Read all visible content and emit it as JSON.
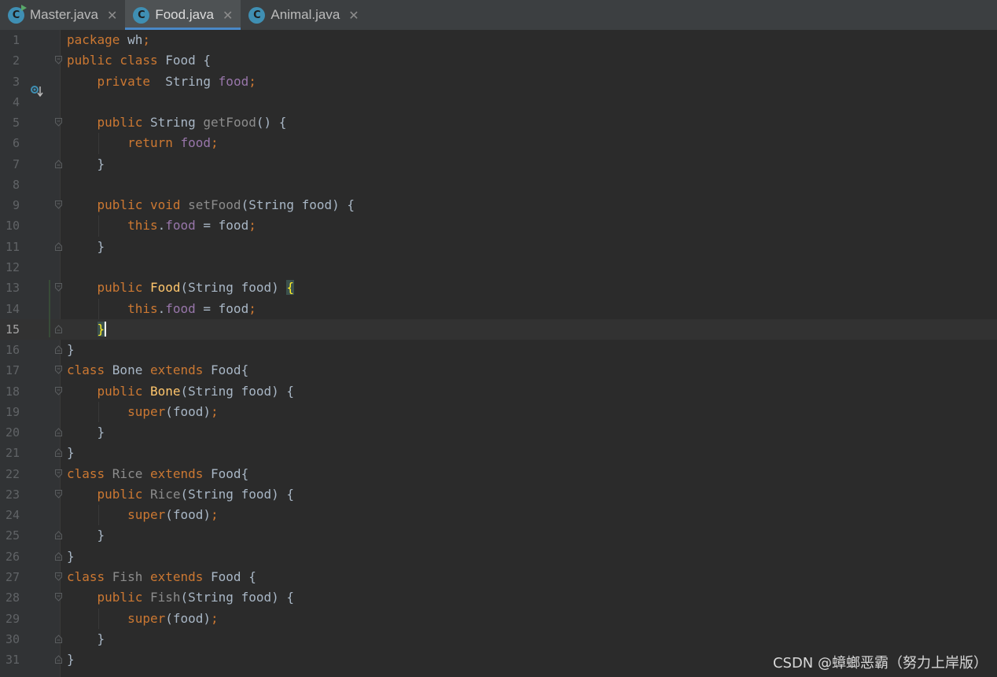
{
  "tabs": [
    {
      "name": "Master.java",
      "icon": "java-class-run-icon",
      "active": false
    },
    {
      "name": "Food.java",
      "icon": "java-class-icon",
      "active": true
    },
    {
      "name": "Animal.java",
      "icon": "java-class-icon",
      "active": false
    }
  ],
  "tab_close_glyph": "✕",
  "tab_icon_letter": "C",
  "editor": {
    "current_line": 15,
    "lines": [
      {
        "n": "1",
        "tokens": [
          [
            "package",
            "kw"
          ],
          [
            " wh",
            "plain"
          ],
          [
            ";",
            "kw"
          ]
        ]
      },
      {
        "n": "2",
        "tokens": [
          [
            "public class ",
            "kw"
          ],
          [
            "Food {",
            "plain"
          ]
        ]
      },
      {
        "n": "3",
        "tokens": [
          [
            "    private  ",
            "kw"
          ],
          [
            "String ",
            "plain"
          ],
          [
            "food",
            "field"
          ],
          [
            ";",
            "kw"
          ]
        ]
      },
      {
        "n": "4",
        "tokens": []
      },
      {
        "n": "5",
        "tokens": [
          [
            "    public ",
            "kw"
          ],
          [
            "String ",
            "plain"
          ],
          [
            "getFood",
            "dim"
          ],
          [
            "() {",
            "plain"
          ]
        ]
      },
      {
        "n": "6",
        "tokens": [
          [
            "        return ",
            "kw"
          ],
          [
            "food",
            "field"
          ],
          [
            ";",
            "kw"
          ]
        ]
      },
      {
        "n": "7",
        "tokens": [
          [
            "    }",
            "plain"
          ]
        ]
      },
      {
        "n": "8",
        "tokens": []
      },
      {
        "n": "9",
        "tokens": [
          [
            "    public void ",
            "kw"
          ],
          [
            "setFood",
            "dim"
          ],
          [
            "(String food) {",
            "plain"
          ]
        ]
      },
      {
        "n": "10",
        "tokens": [
          [
            "        this",
            "kw"
          ],
          [
            ".",
            "plain"
          ],
          [
            "food",
            "field"
          ],
          [
            " = food",
            "plain"
          ],
          [
            ";",
            "kw"
          ]
        ]
      },
      {
        "n": "11",
        "tokens": [
          [
            "    }",
            "plain"
          ]
        ]
      },
      {
        "n": "12",
        "tokens": []
      },
      {
        "n": "13",
        "tokens": [
          [
            "    public ",
            "kw"
          ],
          [
            "Food",
            "decl"
          ],
          [
            "(String food) ",
            "plain"
          ],
          [
            "{",
            "brace"
          ]
        ]
      },
      {
        "n": "14",
        "tokens": [
          [
            "        this",
            "kw"
          ],
          [
            ".",
            "plain"
          ],
          [
            "food",
            "field"
          ],
          [
            " = food",
            "plain"
          ],
          [
            ";",
            "kw"
          ]
        ]
      },
      {
        "n": "15",
        "tokens": [
          [
            "    ",
            "plain"
          ],
          [
            "}",
            "cursor"
          ]
        ]
      },
      {
        "n": "16",
        "tokens": [
          [
            "}",
            "plain"
          ]
        ]
      },
      {
        "n": "17",
        "tokens": [
          [
            "class ",
            "kw"
          ],
          [
            "Bone ",
            "plain"
          ],
          [
            "extends ",
            "kw"
          ],
          [
            "Food{",
            "plain"
          ]
        ]
      },
      {
        "n": "18",
        "tokens": [
          [
            "    public ",
            "kw"
          ],
          [
            "Bone",
            "decl"
          ],
          [
            "(String food) {",
            "plain"
          ]
        ]
      },
      {
        "n": "19",
        "tokens": [
          [
            "        super",
            "kw"
          ],
          [
            "(food)",
            "plain"
          ],
          [
            ";",
            "kw"
          ]
        ]
      },
      {
        "n": "20",
        "tokens": [
          [
            "    }",
            "plain"
          ]
        ]
      },
      {
        "n": "21",
        "tokens": [
          [
            "}",
            "plain"
          ]
        ]
      },
      {
        "n": "22",
        "tokens": [
          [
            "class ",
            "kw"
          ],
          [
            "Rice ",
            "dim"
          ],
          [
            "extends ",
            "kw"
          ],
          [
            "Food{",
            "plain"
          ]
        ]
      },
      {
        "n": "23",
        "tokens": [
          [
            "    public ",
            "kw"
          ],
          [
            "Rice",
            "dim"
          ],
          [
            "(String food) {",
            "plain"
          ]
        ]
      },
      {
        "n": "24",
        "tokens": [
          [
            "        super",
            "kw"
          ],
          [
            "(food)",
            "plain"
          ],
          [
            ";",
            "kw"
          ]
        ]
      },
      {
        "n": "25",
        "tokens": [
          [
            "    }",
            "plain"
          ]
        ]
      },
      {
        "n": "26",
        "tokens": [
          [
            "}",
            "plain"
          ]
        ]
      },
      {
        "n": "27",
        "tokens": [
          [
            "class ",
            "kw"
          ],
          [
            "Fish ",
            "dim"
          ],
          [
            "extends ",
            "kw"
          ],
          [
            "Food {",
            "plain"
          ]
        ]
      },
      {
        "n": "28",
        "tokens": [
          [
            "    public ",
            "kw"
          ],
          [
            "Fish",
            "dim"
          ],
          [
            "(String food) {",
            "plain"
          ]
        ]
      },
      {
        "n": "29",
        "tokens": [
          [
            "        super",
            "kw"
          ],
          [
            "(food)",
            "plain"
          ],
          [
            ";",
            "kw"
          ]
        ]
      },
      {
        "n": "30",
        "tokens": [
          [
            "    }",
            "plain"
          ]
        ]
      },
      {
        "n": "31",
        "tokens": [
          [
            "}",
            "plain"
          ]
        ]
      }
    ]
  },
  "watermark": "CSDN @蟑螂恶霸（努力上岸版）",
  "colors": {
    "keyword": "#cc7832",
    "field": "#9876aa",
    "declaration": "#ffc66d",
    "plain": "#a9b7c6",
    "unused": "#8c8c8c",
    "tab_accent": "#4a88c7"
  }
}
